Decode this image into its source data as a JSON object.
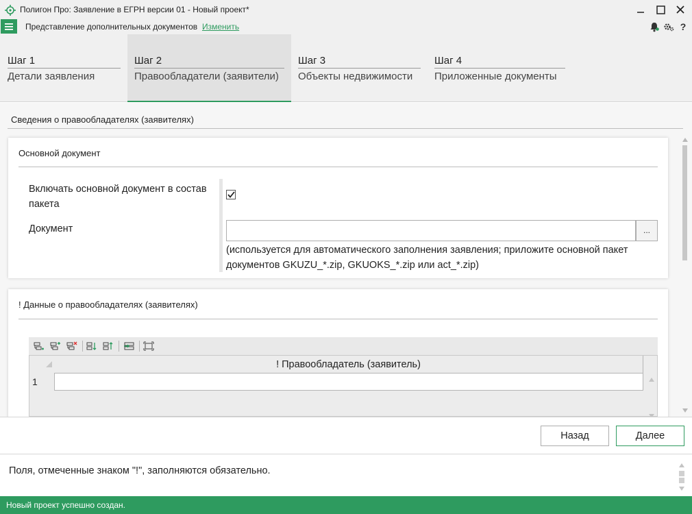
{
  "window": {
    "title": "Полигон Про: Заявление в ЕГРН версии 01 - Новый проект*",
    "minimize_icon": "minimize-icon",
    "maximize_icon": "maximize-icon",
    "close_icon": "close-icon"
  },
  "menu": {
    "caption": "Представление дополнительных документов",
    "change_link": "Изменить",
    "icons": [
      "menu-icon",
      "bell-icon",
      "settings-icon",
      "help-icon"
    ]
  },
  "steps": [
    {
      "num": "Шаг 1",
      "label": "Детали заявления",
      "active": false
    },
    {
      "num": "Шаг 2",
      "label": "Правообладатели (заявители)",
      "active": true
    },
    {
      "num": "Шаг 3",
      "label": "Объекты недвижимости",
      "active": false
    },
    {
      "num": "Шаг 4",
      "label": "Приложенные документы",
      "active": false
    }
  ],
  "content": {
    "section_title": "Сведения о правообладателях (заявителях)",
    "main_doc": {
      "title": "Основной документ",
      "include_label": "Включать основной документ в состав пакета",
      "include_checked": true,
      "document_label": "Документ",
      "document_value": "",
      "browse_label": "...",
      "hint": "(используется для автоматического заполнения заявления; приложите основной пакет документов GKUZU_*.zip, GKUOKS_*.zip или act_*.zip)"
    },
    "holders": {
      "title": "! Данные о правообладателях (заявителях)",
      "toolbar_icons": [
        "add-row-icon",
        "add-child-row-icon",
        "delete-row-icon",
        "move-down-icon",
        "move-up-icon",
        "import-icon",
        "fit-icon"
      ],
      "column_header": "! Правообладатель (заявитель)",
      "rows": [
        {
          "num": "1",
          "value": ""
        }
      ]
    }
  },
  "buttons": {
    "back": "Назад",
    "next": "Далее"
  },
  "info": {
    "text": "Поля, отмеченные знаком \"!\", заполняются обязательно."
  },
  "status": {
    "text": "Новый проект успешно создан."
  },
  "colors": {
    "accent": "#2e9b5f",
    "status_bar": "#2e9b5f",
    "link": "#2e9b5f"
  }
}
